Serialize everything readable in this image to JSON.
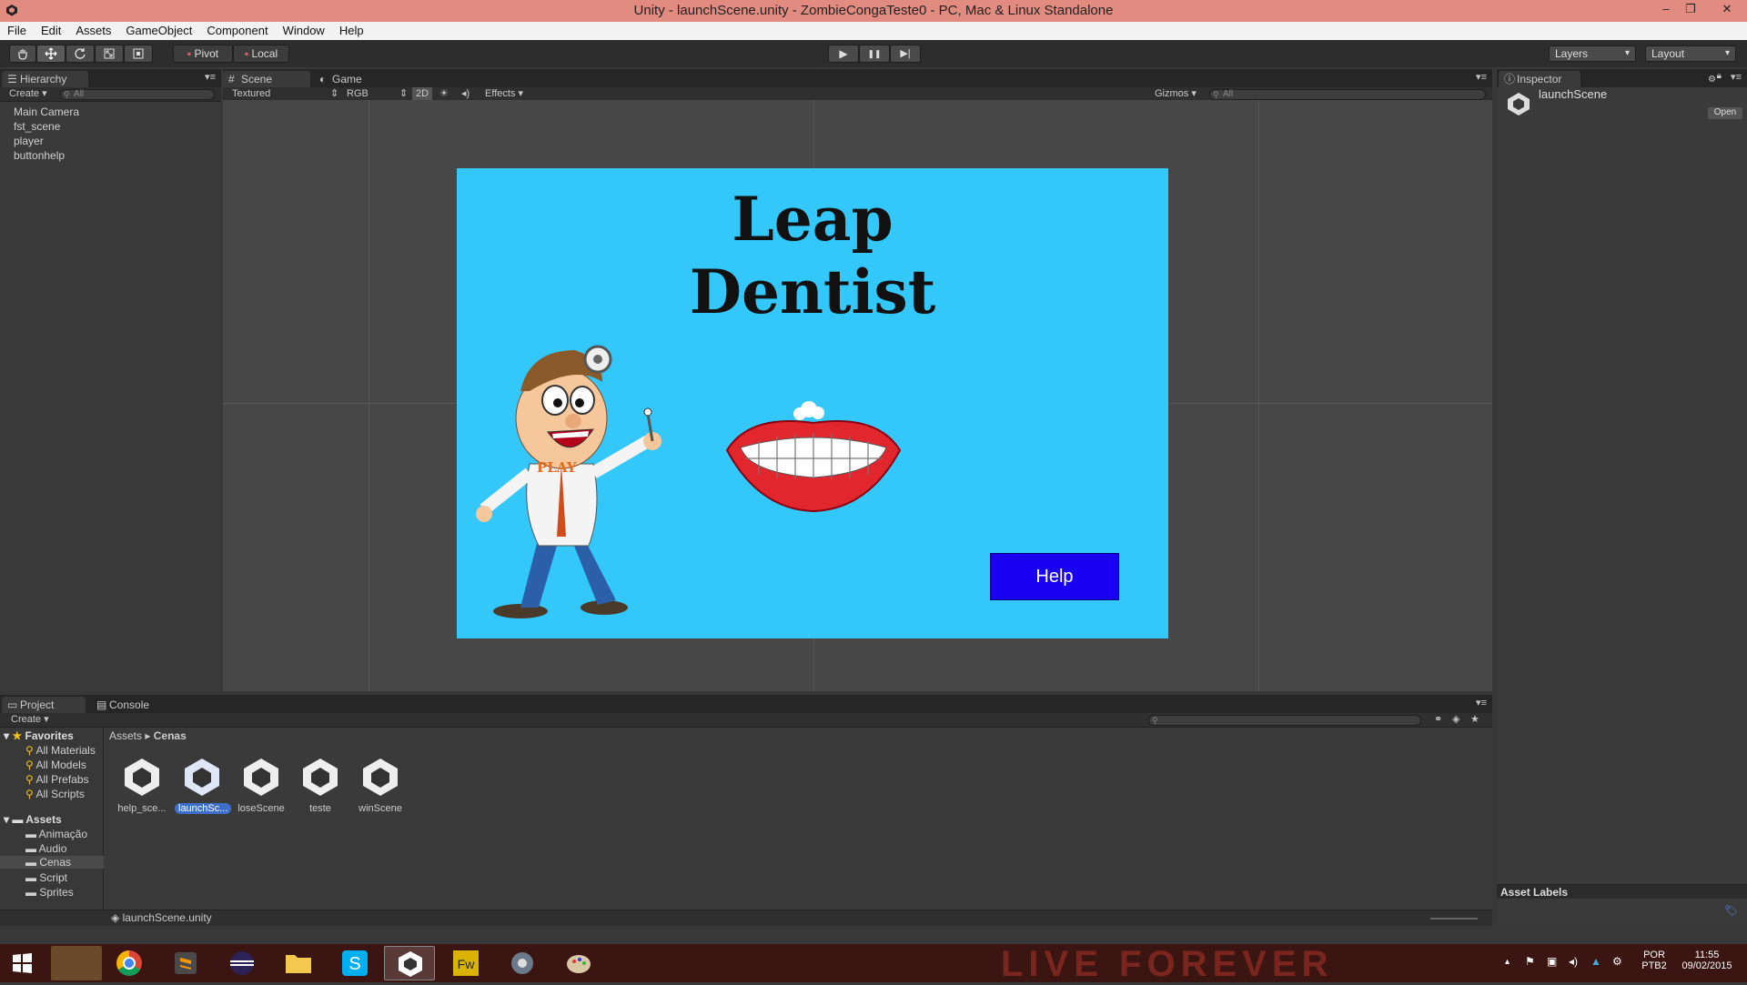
{
  "window": {
    "title": "Unity - launchScene.unity - ZombieCongaTeste0 - PC, Mac & Linux Standalone",
    "minimize": "–",
    "restore": "❐",
    "close": "✕"
  },
  "menu": [
    "File",
    "Edit",
    "Assets",
    "GameObject",
    "Component",
    "Window",
    "Help"
  ],
  "toolbar": {
    "tools": [
      "hand-icon",
      "move-icon",
      "rotate-icon",
      "scale-icon",
      "rect-icon"
    ],
    "pivot": "Pivot",
    "local": "Local",
    "play": "▶",
    "pause": "❚❚",
    "step": "▶|",
    "layers": "Layers",
    "layout": "Layout"
  },
  "hierarchy": {
    "tab": "Hierarchy",
    "create": "Create",
    "search_placeholder": "All",
    "items": [
      "Main Camera",
      "fst_scene",
      "player",
      "buttonhelp"
    ]
  },
  "scene": {
    "tabs": [
      "Scene",
      "Game"
    ],
    "shading": "Textured",
    "render_mode": "RGB",
    "mode_2d": "2D",
    "effects": "Effects",
    "gizmos": "Gizmos",
    "search_placeholder": "All"
  },
  "game": {
    "title_line1": "Leap",
    "title_line2": "Dentist",
    "play_text": "PLAY",
    "help_button": "Help",
    "colors": {
      "background": "#33c7fa",
      "button": "#1a00f3"
    }
  },
  "inspector": {
    "tab": "Inspector",
    "object_name": "launchScene",
    "open_button": "Open",
    "asset_labels": "Asset Labels"
  },
  "project": {
    "tabs": [
      "Project",
      "Console"
    ],
    "create": "Create",
    "favorites_label": "Favorites",
    "favorites": [
      "All Materials",
      "All Models",
      "All Prefabs",
      "All Scripts"
    ],
    "assets_label": "Assets",
    "folders": [
      "Animação",
      "Audio",
      "Cenas",
      "Script",
      "Sprites"
    ],
    "selected_folder": "Cenas",
    "breadcrumb": [
      "Assets",
      "Cenas"
    ],
    "files": [
      "help_sce...",
      "launchSc...",
      "loseScene",
      "teste",
      "winScene"
    ],
    "selected_file": "launchSc...",
    "status_file": "launchScene.unity"
  },
  "taskbar": {
    "apps": [
      "windows-start-icon",
      "file-explorer-icon",
      "chrome-icon",
      "sublime-icon",
      "eclipse-icon",
      "folder-icon",
      "skype-icon",
      "unity-icon",
      "fireworks-icon",
      "tool-icon",
      "paint-icon"
    ],
    "wallpaper_text": "LIVE FOREVER",
    "lang_line1": "POR",
    "lang_line2": "PTB2",
    "time": "11:55",
    "date": "09/02/2015"
  }
}
